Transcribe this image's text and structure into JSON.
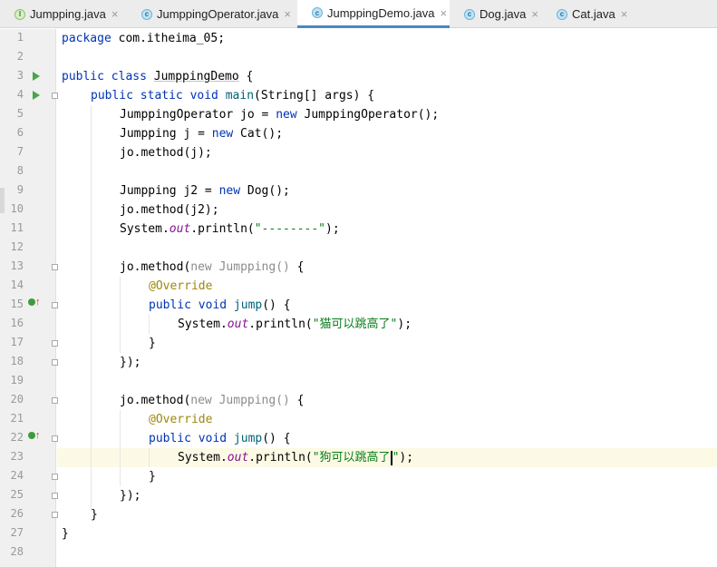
{
  "tabs": [
    {
      "label": "Jumpping.java",
      "icon": "interface-icon",
      "active": false
    },
    {
      "label": "JumppingOperator.java",
      "icon": "class-icon",
      "active": false
    },
    {
      "label": "JumppingDemo.java",
      "icon": "class-icon",
      "active": true
    },
    {
      "label": "Dog.java",
      "icon": "class-icon",
      "active": false
    },
    {
      "label": "Cat.java",
      "icon": "class-icon",
      "active": false
    }
  ],
  "line_numbers": [
    "1",
    "2",
    "3",
    "4",
    "5",
    "6",
    "7",
    "8",
    "9",
    "10",
    "11",
    "12",
    "13",
    "14",
    "15",
    "16",
    "17",
    "18",
    "19",
    "20",
    "21",
    "22",
    "23",
    "24",
    "25",
    "26",
    "27",
    "28"
  ],
  "code": {
    "l1_kw": "package",
    "l1_rest": " com.itheima_05;",
    "l3_kw": "public class",
    "l3_name": "JumppingDemo",
    "l3_rest": " {",
    "l4_kw": "public static void",
    "l4_method": "main",
    "l4_rest": "(String[] args) {",
    "l5_a": "JumppingOperator jo = ",
    "l5_kw": "new",
    "l5_b": " JumppingOperator();",
    "l6_a": "Jumpping j = ",
    "l6_kw": "new",
    "l6_b": " Cat();",
    "l7": "jo.method(j);",
    "l9_a": "Jumpping j2 = ",
    "l9_kw": "new",
    "l9_b": " Dog();",
    "l10": "jo.method(j2);",
    "l11_a": "System.",
    "l11_out": "out",
    "l11_b": ".println(",
    "l11_str": "\"--------\"",
    "l11_c": ");",
    "l13_a": "jo.method(",
    "l13_dim": "new Jumpping()",
    "l13_b": " {",
    "l14": "@Override",
    "l15_kw": "public void",
    "l15_method": "jump",
    "l15_rest": "() {",
    "l16_a": "System.",
    "l16_out": "out",
    "l16_b": ".println(",
    "l16_str": "\"猫可以跳高了\"",
    "l16_c": ");",
    "l17": "}",
    "l18": "});",
    "l20_a": "jo.method(",
    "l20_dim": "new Jumpping()",
    "l20_b": " {",
    "l21": "@Override",
    "l22_kw": "public void",
    "l22_method": "jump",
    "l22_rest": "() {",
    "l23_a": "System.",
    "l23_out": "out",
    "l23_b": ".println(",
    "l23_str1": "\"狗可以跳高了",
    "l23_str2": "\"",
    "l23_c": ");",
    "l24": "}",
    "l25": "});",
    "l26": "}",
    "l27": "}"
  },
  "colors": {
    "keyword": "#0033b3",
    "string": "#067d17",
    "annotation": "#9e880d",
    "static_field": "#871094",
    "run_icon": "#4aa54a"
  }
}
